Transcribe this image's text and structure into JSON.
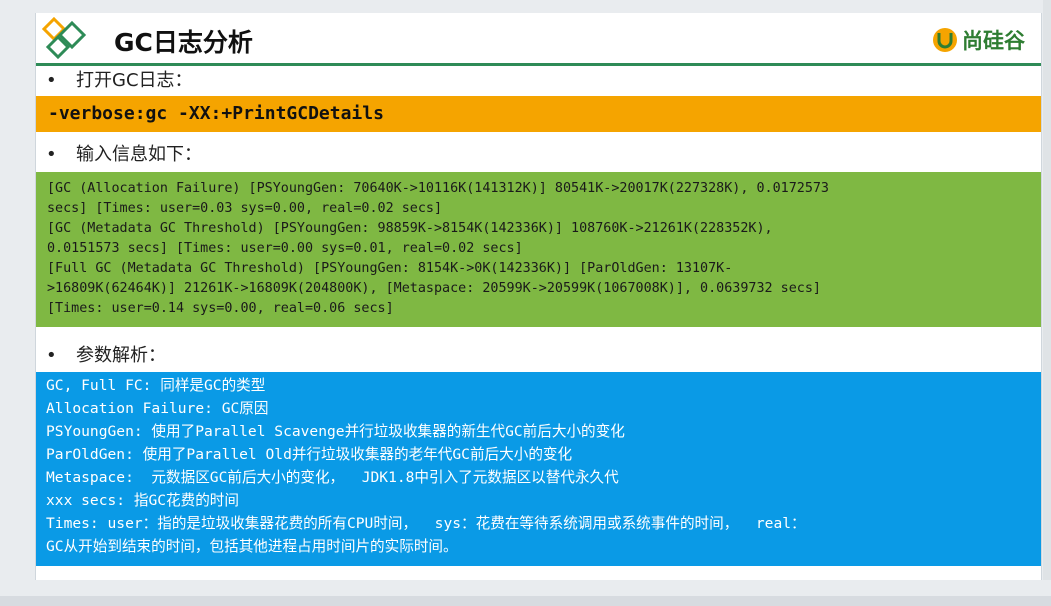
{
  "title": "GC日志分析",
  "brand": "尚硅谷",
  "bullets": {
    "b1": "打开GC日志：",
    "b2": "输入信息如下：",
    "b3": "参数解析："
  },
  "command": "-verbose:gc -XX:+PrintGCDetails",
  "log_lines": [
    "[GC (Allocation Failure) [PSYoungGen: 70640K->10116K(141312K)] 80541K->20017K(227328K), 0.0172573",
    "secs] [Times: user=0.03 sys=0.00, real=0.02 secs]",
    "[GC (Metadata GC Threshold) [PSYoungGen: 98859K->8154K(142336K)] 108760K->21261K(228352K),",
    "0.0151573 secs] [Times: user=0.00 sys=0.01, real=0.02 secs]",
    "[Full GC (Metadata GC Threshold) [PSYoungGen: 8154K->0K(142336K)] [ParOldGen: 13107K-",
    ">16809K(62464K)] 21261K->16809K(204800K), [Metaspace: 20599K->20599K(1067008K)], 0.0639732 secs]",
    "[Times: user=0.14 sys=0.00, real=0.06 secs]"
  ],
  "explain_lines": [
    "GC, Full FC: 同样是GC的类型",
    "Allocation Failure: GC原因",
    "PSYoungGen: 使用了Parallel Scavenge并行垃圾收集器的新生代GC前后大小的变化",
    "ParOldGen: 使用了Parallel Old并行垃圾收集器的老年代GC前后大小的变化",
    "Metaspace:  元数据区GC前后大小的变化，  JDK1.8中引入了元数据区以替代永久代",
    "xxx secs: 指GC花费的时间",
    "Times: user：指的是垃圾收集器花费的所有CPU时间，  sys：花费在等待系统调用或系统事件的时间，  real：",
    "GC从开始到结束的时间，包括其他进程占用时间片的实际时间。"
  ],
  "colors": {
    "orange": "#f5a400",
    "green": "#7fb843",
    "blue": "#0a9ae6",
    "rule": "#2e8b57"
  },
  "icons": {
    "logo": "diamond-logo-icon",
    "brand": "brand-u-icon",
    "bullet": "bullet-dot-icon"
  }
}
